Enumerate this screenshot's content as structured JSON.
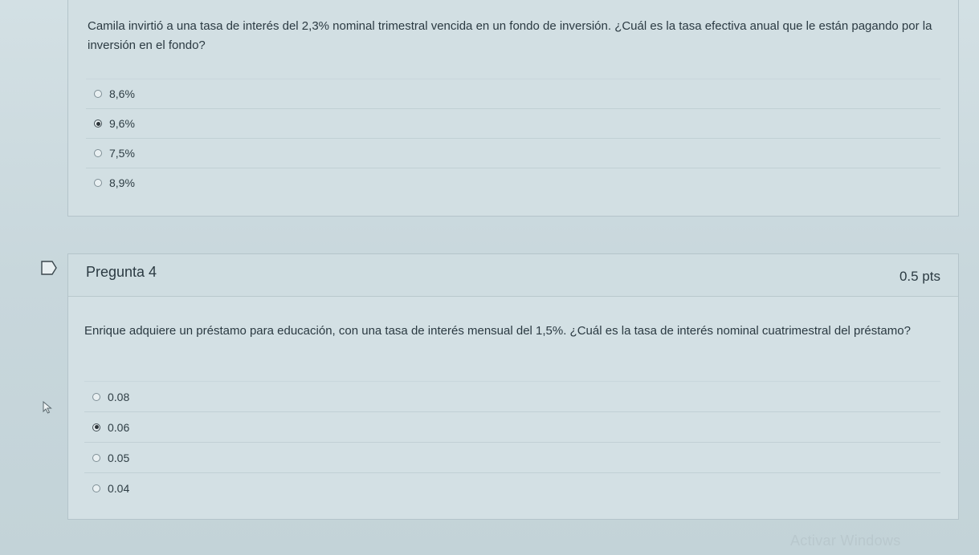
{
  "question3": {
    "text": "Camila invirtió a una tasa de interés del 2,3% nominal trimestral vencida en un fondo de inversión. ¿Cuál es la tasa efectiva anual que le están pagando por la inversión en el fondo?",
    "options": [
      {
        "label": "8,6%",
        "selected": false
      },
      {
        "label": "9,6%",
        "selected": true
      },
      {
        "label": "7,5%",
        "selected": false
      },
      {
        "label": "8,9%",
        "selected": false
      }
    ]
  },
  "question4": {
    "title": "Pregunta 4",
    "points": "0.5 pts",
    "text": "Enrique adquiere un préstamo para educación, con una tasa de interés mensual del 1,5%. ¿Cuál es la tasa de interés nominal cuatrimestral del préstamo?",
    "options": [
      {
        "label": "0.08",
        "selected": false
      },
      {
        "label": "0.06",
        "selected": true
      },
      {
        "label": "0.05",
        "selected": false
      },
      {
        "label": "0.04",
        "selected": false
      }
    ]
  },
  "icons": {
    "flag": "flag-icon",
    "cursor": "mouse-pointer-icon"
  },
  "watermark": "Activar Windows"
}
